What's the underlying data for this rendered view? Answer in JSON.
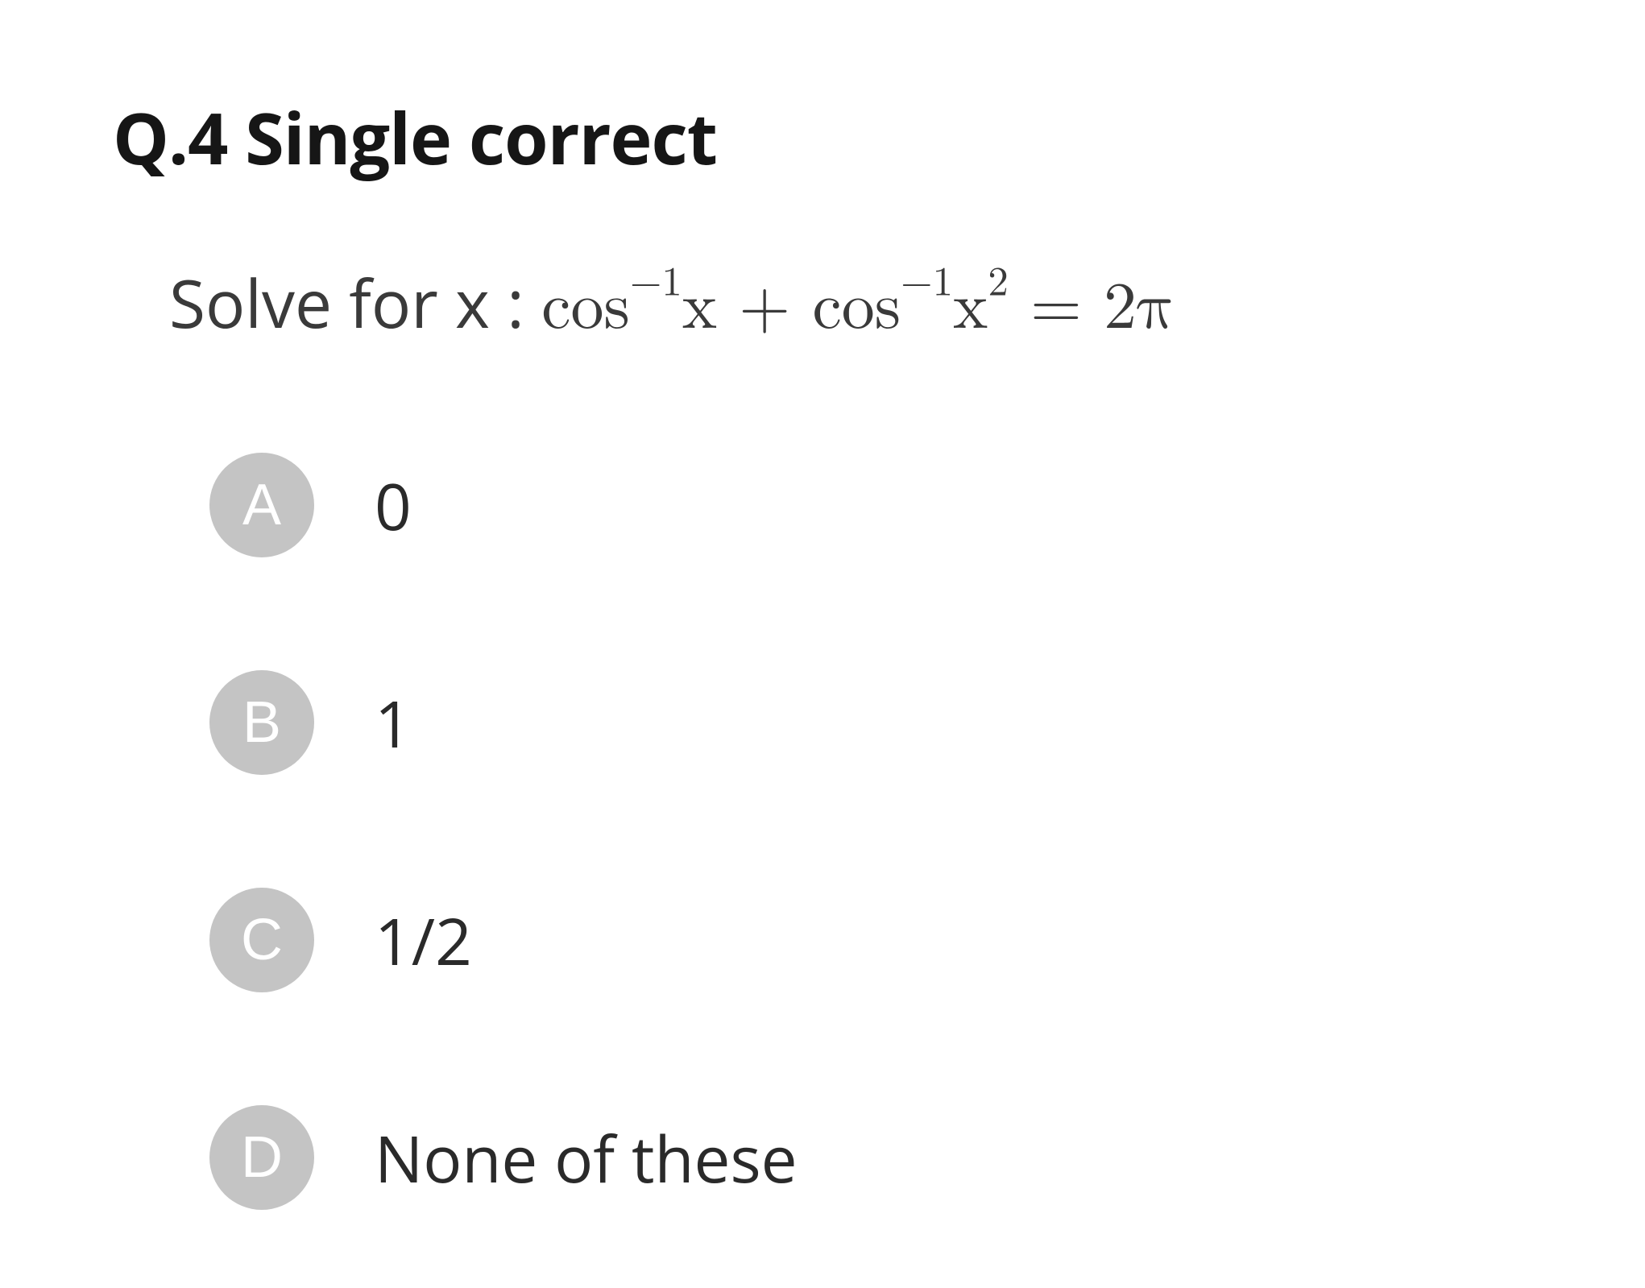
{
  "heading": "Q.4 Single correct",
  "question_prefix": "Solve for x : ",
  "equation": {
    "cos1": "cos",
    "exp1": "−1",
    "var1": "x",
    "plus": " + ",
    "cos2": "cos",
    "exp2": "−1",
    "var2": "x",
    "sq": "2",
    "eq": " = ",
    "rhs": "2π"
  },
  "options": [
    {
      "letter": "A",
      "text": "0"
    },
    {
      "letter": "B",
      "text": "1"
    },
    {
      "letter": "C",
      "text": "1/2"
    },
    {
      "letter": "D",
      "text": "None of these"
    }
  ]
}
